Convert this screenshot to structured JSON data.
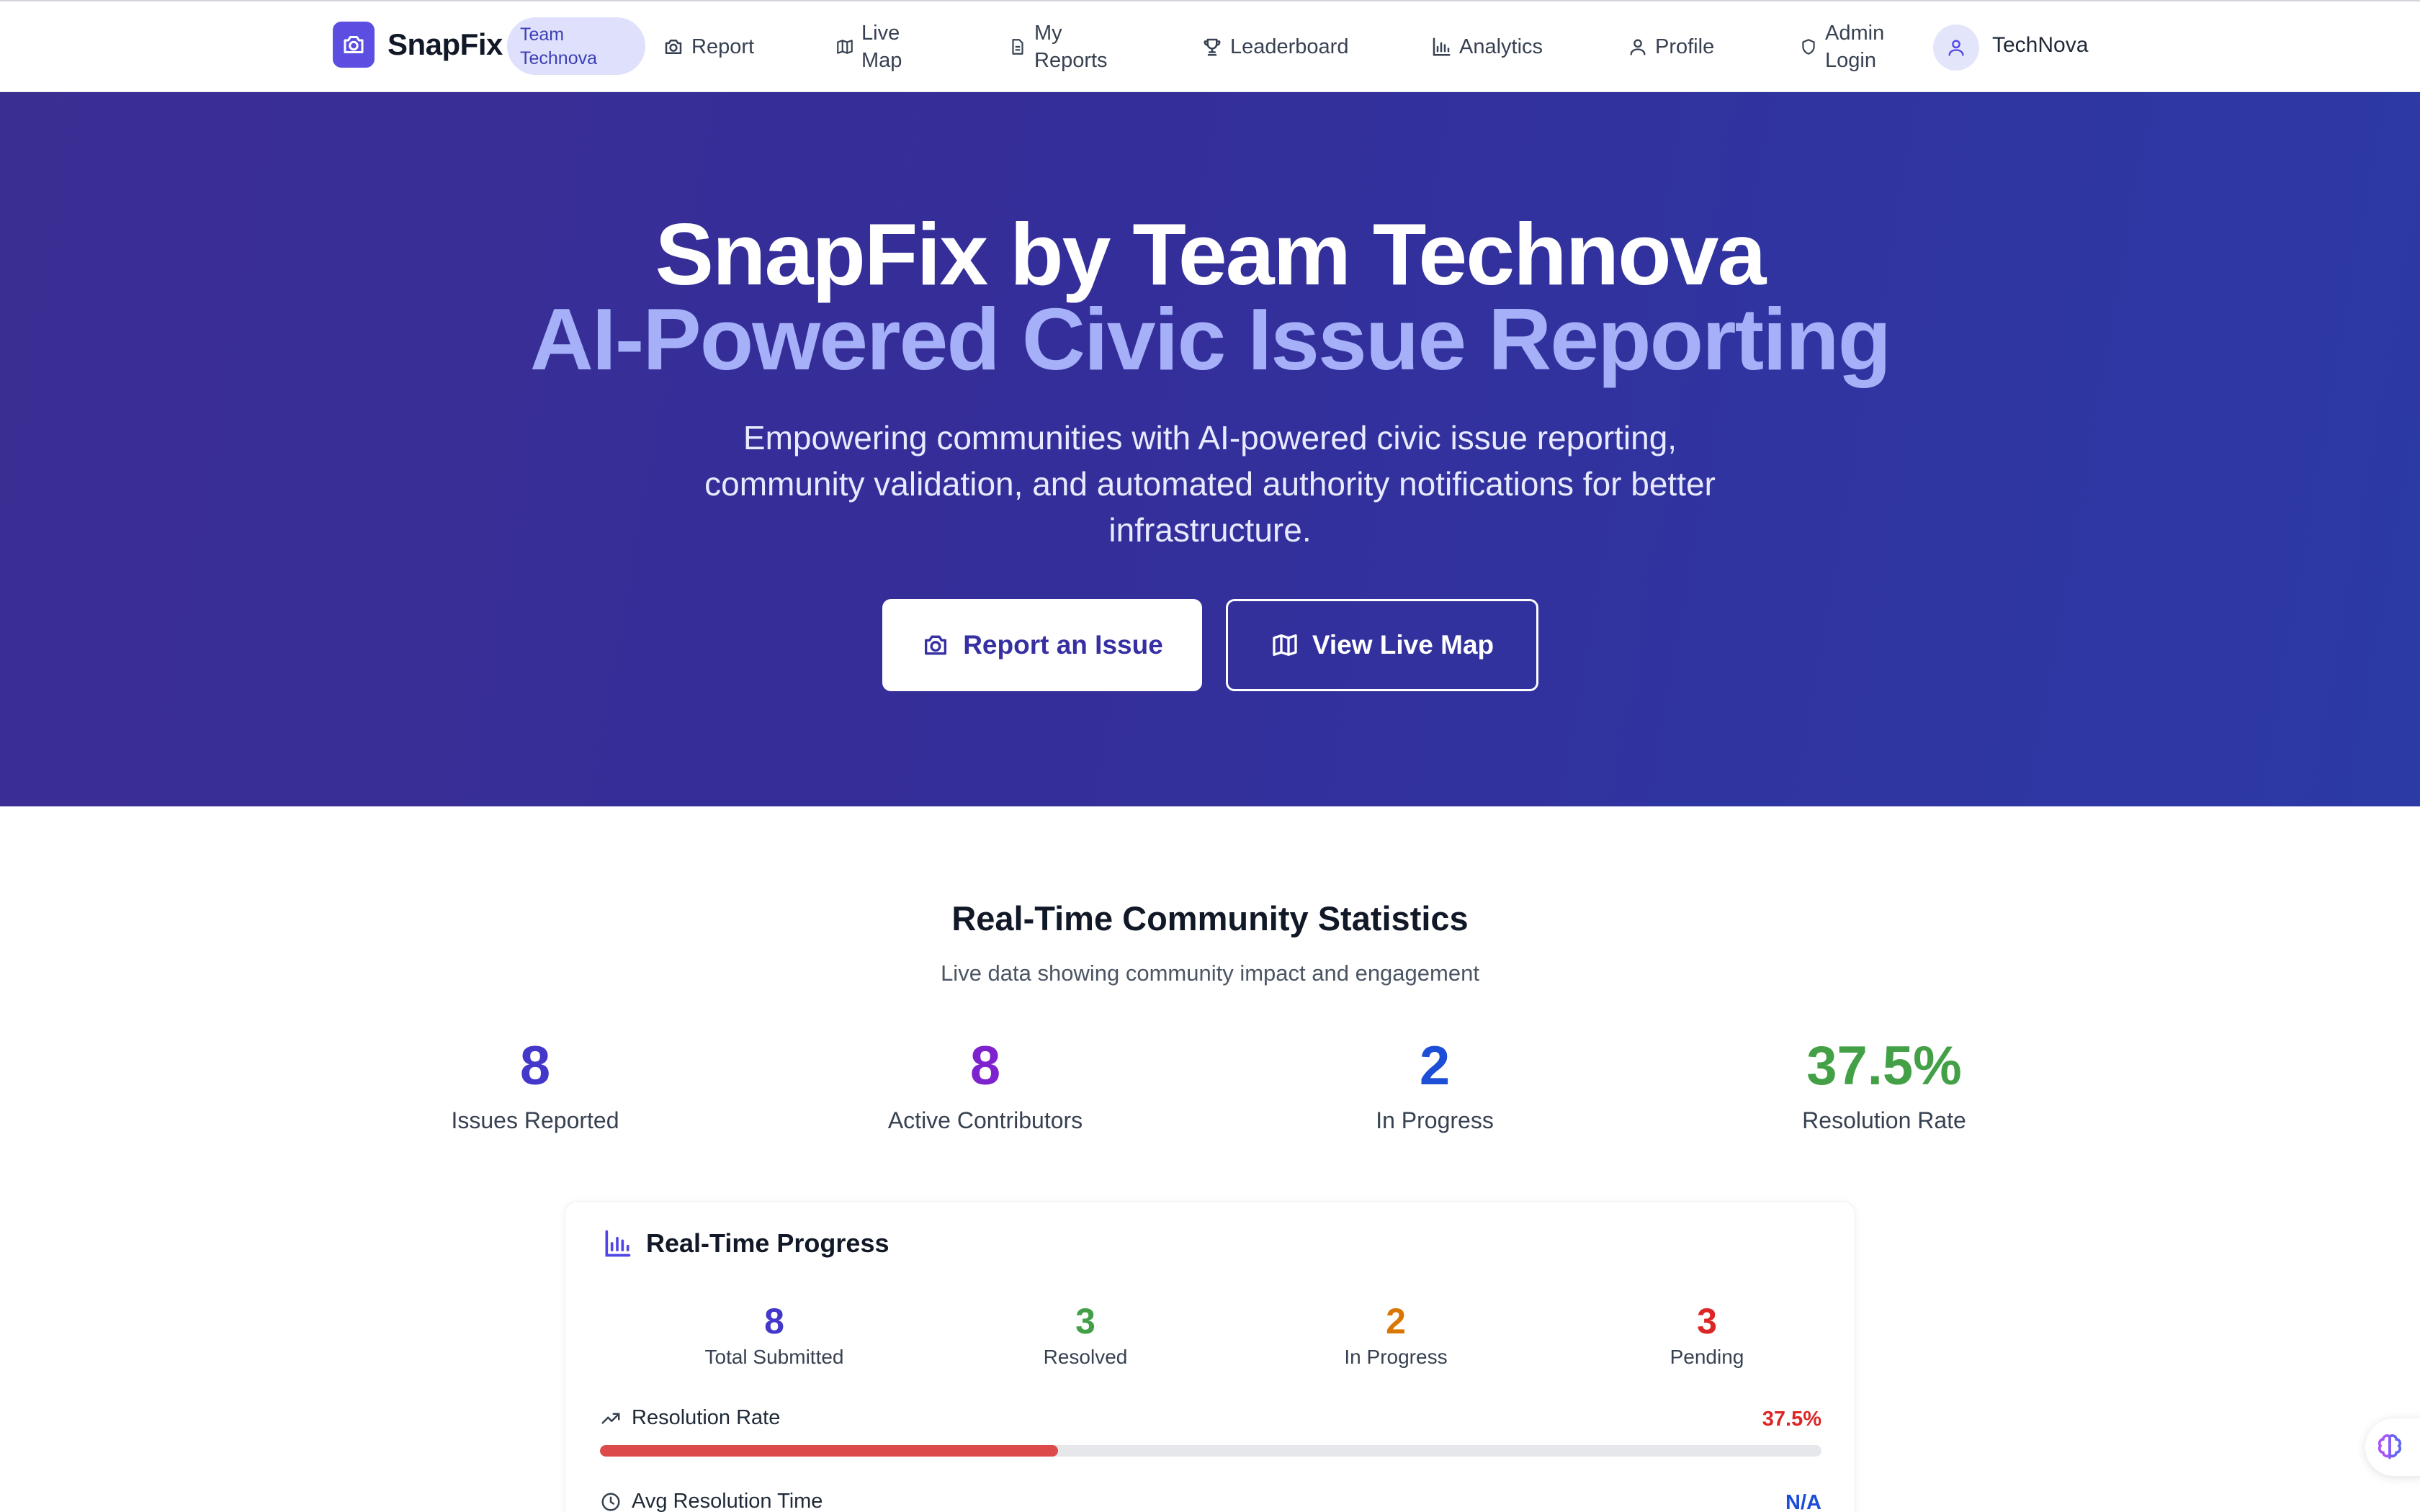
{
  "nav": {
    "brand": "SnapFix",
    "team_badge": "Team Technova",
    "items": [
      {
        "label": "Report",
        "icon": "camera-icon"
      },
      {
        "label": "Live\nMap",
        "icon": "map-icon"
      },
      {
        "label": "My\nReports",
        "icon": "file-text-icon"
      },
      {
        "label": "Leaderboard",
        "icon": "trophy-icon"
      },
      {
        "label": "Analytics",
        "icon": "bar-chart-icon"
      },
      {
        "label": "Profile",
        "icon": "user-icon"
      },
      {
        "label": "Admin\nLogin",
        "icon": "shield-icon"
      }
    ],
    "user_name": "TechNova"
  },
  "hero": {
    "title_line1": "SnapFix by Team Technova",
    "title_line2": "AI-Powered Civic Issue Reporting",
    "subtitle": "Empowering communities with AI-powered civic issue reporting, community validation, and automated authority notifications for better infrastructure.",
    "primary_button": "Report an Issue",
    "secondary_button": "View Live Map"
  },
  "stats": {
    "title": "Real-Time Community Statistics",
    "subtitle": "Live data showing community impact and engagement",
    "items": [
      {
        "value": "8",
        "label": "Issues Reported",
        "color": "#4338ca"
      },
      {
        "value": "8",
        "label": "Active Contributors",
        "color": "#7e22ce"
      },
      {
        "value": "2",
        "label": "In Progress",
        "color": "#1d4ed8"
      },
      {
        "value": "37.5%",
        "label": "Resolution Rate",
        "color": "#43a047"
      }
    ]
  },
  "progress": {
    "title": "Real-Time Progress",
    "items": [
      {
        "value": "8",
        "label": "Total Submitted",
        "color": "#4338ca"
      },
      {
        "value": "3",
        "label": "Resolved",
        "color": "#43a047"
      },
      {
        "value": "2",
        "label": "In Progress",
        "color": "#d97706"
      },
      {
        "value": "3",
        "label": "Pending",
        "color": "#dc2626"
      }
    ],
    "resolution_label": "Resolution Rate",
    "resolution_value": "37.5%",
    "resolution_fraction": 0.375,
    "avg_label": "Avg Resolution Time",
    "avg_value": "N/A"
  },
  "colors": {
    "brand": "#5b4ee0",
    "hero_bg": "#342e9a",
    "hero_accent": "#a5b0f8"
  }
}
